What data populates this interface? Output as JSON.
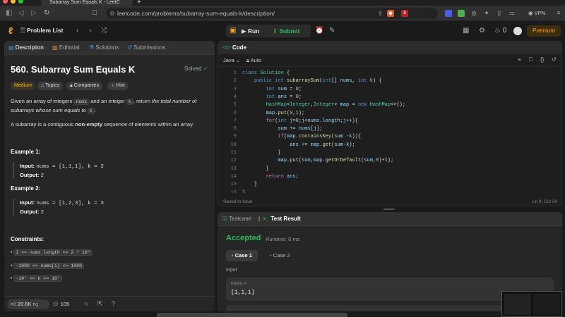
{
  "browser": {
    "tab_title": "Subarray Sum Equals K - LeetC",
    "url": "leetcode.com/problems/subarray-sum-equals-k/description/",
    "vpn_label": "VPN",
    "badge_count": "8"
  },
  "header": {
    "problem_list": "Problem List",
    "run": "Run",
    "submit": "Submit",
    "streak": "0",
    "premium": "Premium"
  },
  "left_tabs": [
    "Description",
    "Editorial",
    "Solutions",
    "Submissions"
  ],
  "problem": {
    "title": "560. Subarray Sum Equals K",
    "status": "Solved",
    "difficulty": "Medium",
    "tags": [
      "Topics",
      "Companies",
      "Hint"
    ],
    "desc_a": "Given an array of integers ",
    "desc_code1": "nums",
    "desc_b": " and an integer ",
    "desc_code2": "k",
    "desc_c": ", return ",
    "desc_em": "the total number of subarrays whose sum equals to",
    "desc_code3": "k",
    "desc_d": ".",
    "desc2_a": "A subarray is a contiguous ",
    "desc2_b": "non-empty",
    "desc2_c": " sequence of elements within an array.",
    "examples": [
      {
        "title": "Example 1:",
        "input": "nums = [1,1,1], k = 2",
        "output": "2"
      },
      {
        "title": "Example 2:",
        "input": "nums = [1,2,3], k = 3",
        "output": "2"
      }
    ],
    "input_label": "Input:",
    "output_label": "Output:",
    "constraints_title": "Constraints:",
    "constraints": [
      "1 <= nums.length <= 2 * 10⁴",
      "-1000 <= nums[i] <= 1000",
      "-10⁷ <= k <= 10⁷"
    ],
    "likes": "20.6K",
    "comments": "105"
  },
  "code_panel": {
    "title": "Code",
    "language": "Java",
    "mode": "Auto",
    "status": "Saved to local",
    "cursor": "Ln 9, Col 24",
    "line_numbers": [
      "1",
      "2",
      "3",
      "4",
      "5",
      "6",
      "7",
      "8",
      "9",
      "10",
      "11",
      "12",
      "13",
      "14",
      "15",
      "16"
    ]
  },
  "test_panel": {
    "tab1": "Testcase",
    "tab2": "Test Result",
    "result": "Accepted",
    "runtime": "Runtime: 0 ms",
    "cases": [
      "Case 1",
      "Case 2"
    ],
    "input_label": "Input",
    "var_name": "nums =",
    "var_value": "[1,1,1]"
  },
  "colors": {
    "accent_green": "#2cbb5d",
    "medium": "#ffb800",
    "premium": "#ffa116"
  }
}
